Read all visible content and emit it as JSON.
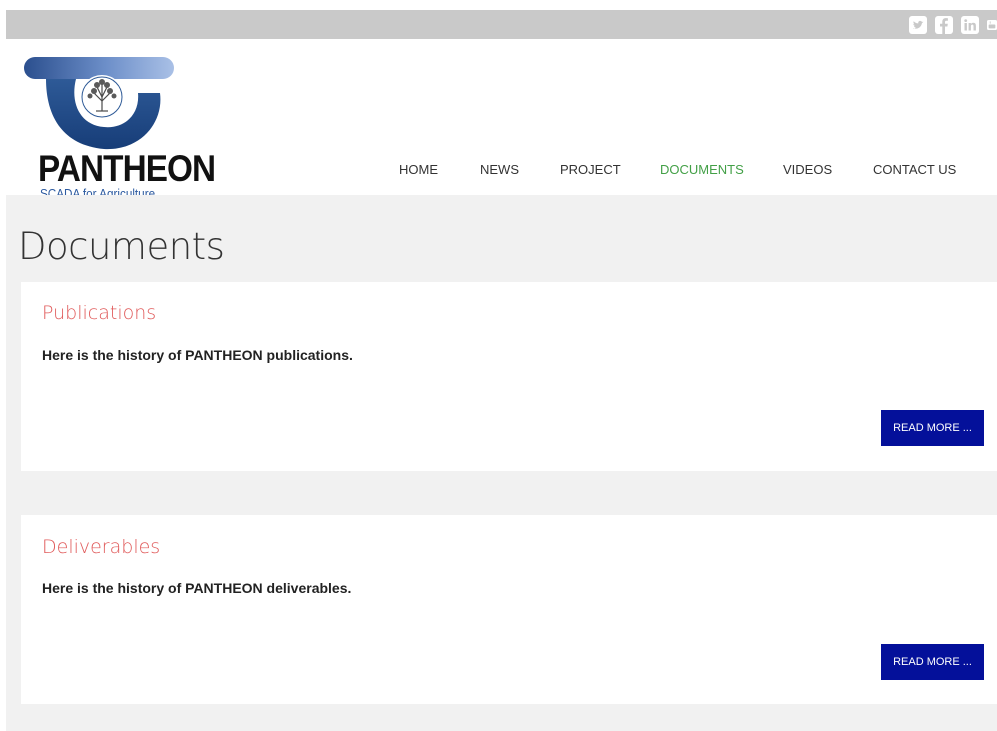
{
  "social": {
    "icons": [
      "twitter-icon",
      "facebook-icon",
      "linkedin-icon",
      "youtube-icon"
    ]
  },
  "logo": {
    "wordmark": "PANTHEON",
    "tagline": "SCADA for Agriculture"
  },
  "nav": {
    "items": [
      {
        "label": "HOME",
        "active": false
      },
      {
        "label": "NEWS",
        "active": false
      },
      {
        "label": "PROJECT",
        "active": false
      },
      {
        "label": "DOCUMENTS",
        "active": true
      },
      {
        "label": "VIDEOS",
        "active": false
      },
      {
        "label": "CONTACT US",
        "active": false
      }
    ]
  },
  "page": {
    "title": "Documents"
  },
  "cards": [
    {
      "title": "Publications",
      "text": "Here is the history of PANTHEON publications.",
      "button": "READ MORE ..."
    },
    {
      "title": "Deliverables",
      "text": "Here is the history of PANTHEON deliverables.",
      "button": "READ MORE ..."
    }
  ],
  "colors": {
    "accent_active_nav": "#43a047",
    "card_title": "#e05a5a",
    "button_bg": "#04109a",
    "logo_blue": "#2c5aa0"
  }
}
